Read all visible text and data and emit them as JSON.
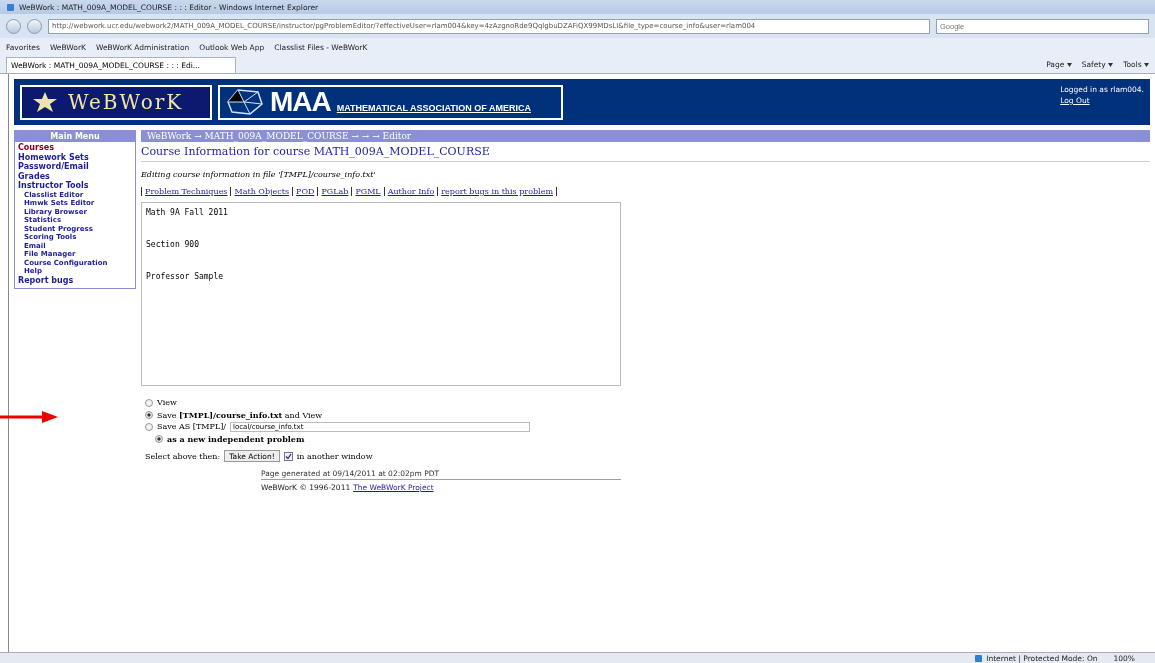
{
  "window": {
    "title": "WeBWork : MATH_009A_MODEL_COURSE : : : Editor - Windows Internet Explorer"
  },
  "address_bar": {
    "url": "http://webwork.ucr.edu/webwork2/MATH_009A_MODEL_COURSE/instructor/pgProblemEditor/?effectiveUser=rlam004&key=4zAzgnoRde9QqlgbuDZAFiQX99MDsLI&file_type=course_info&user=rlam004",
    "search_placeholder": "Google"
  },
  "favorites_bar": {
    "label": "Favorites",
    "links": [
      "WeBWorK",
      "WeBWorK Administration",
      "Outlook Web App",
      "Classlist Files - WeBWorK"
    ]
  },
  "tabs": [
    {
      "label": "WeBWork : MATH_009A_MODEL_COURSE : : : Edi...",
      "selected": true
    }
  ],
  "command_bar": [
    "Page",
    "Safety",
    "Tools"
  ],
  "banner": {
    "logo": "WeBWorK",
    "maa": "MAA",
    "maa_full": "MATHEMATICAL ASSOCIATION OF AMERICA",
    "login": "Logged in as rlam004.",
    "logout": "Log Out"
  },
  "sidebar": {
    "title": "Main Menu",
    "items": [
      {
        "label": "Courses",
        "selected": true
      },
      {
        "label": "Homework Sets",
        "selected": false
      },
      {
        "label": "Password/Email",
        "selected": false
      },
      {
        "label": "Grades",
        "selected": false
      },
      {
        "label": "Instructor Tools",
        "selected": false,
        "children": [
          {
            "label": "Classlist Editor",
            "selected": false
          },
          {
            "label": "Hmwk Sets Editor",
            "selected": false
          },
          {
            "label": "Library Browser",
            "selected": false
          },
          {
            "label": "Statistics",
            "selected": false
          },
          {
            "label": "Student Progress",
            "selected": false
          },
          {
            "label": "Scoring Tools",
            "selected": false
          },
          {
            "label": "Email",
            "selected": false
          },
          {
            "label": "File Manager",
            "selected": false
          },
          {
            "label": "Course Configuration",
            "selected": false
          },
          {
            "label": "Help",
            "selected": false
          }
        ]
      },
      {
        "label": "Report bugs",
        "selected": false
      }
    ]
  },
  "breadcrumb": "WeBWork → MATH_009A_MODEL_COURSE → → → Editor",
  "heading": "Course Information for course MATH_009A_MODEL_COURSE",
  "editing_note": "Editing course information in file '[TMPL]/course_info.txt'",
  "help_links": [
    "Problem Techniques",
    "Math Objects",
    "POD",
    "PGLab",
    "PGML",
    "Author Info",
    "report bugs in this problem"
  ],
  "editor_text": "Math 9A Fall 2011\n\nSection 900\n\nProfessor Sample",
  "actions": [
    {
      "kind": "radio",
      "label": "View",
      "selected": false
    },
    {
      "kind": "radio",
      "label": "Save **[TMPL]/course_info.txt** and View",
      "selected": true
    },
    {
      "kind": "save_as",
      "label": "Save AS [TMPL]/",
      "value": "local/course_info.txt",
      "selected": false
    },
    {
      "kind": "subradio",
      "label": "as a new independent problem",
      "selected": true
    }
  ],
  "submit": {
    "prompt": "Select above then:",
    "button": "Take Action!",
    "checkbox_label": "in another window",
    "checked": true
  },
  "footer": {
    "generated": "Page generated at 09/14/2011 at 02:02pm PDT",
    "copyright": "WeBWorK © 1996-2011",
    "project_link": "The WeBWorK Project"
  },
  "status_bar": {
    "zone": "Internet | Protected Mode: On",
    "zoom": "100%"
  }
}
